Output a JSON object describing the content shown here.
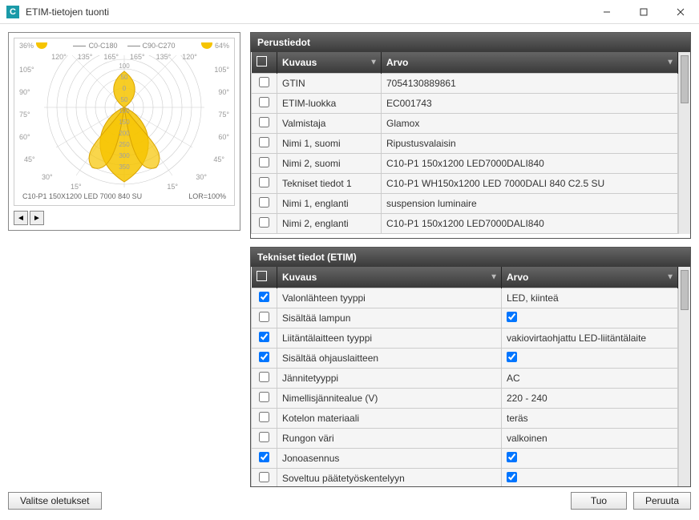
{
  "window": {
    "title": "ETIM-tietojen tuonti",
    "icon_letter": "C"
  },
  "preview": {
    "pct_left": "36%",
    "pct_right": "64%",
    "legend1": "C0-C180",
    "legend2": "C90-C270",
    "caption_left": "C10-P1 150X1200 LED 7000 840 SU",
    "caption_right": "LOR=100%",
    "angle_ticks": [
      "120°",
      "135°",
      "165°",
      "165°",
      "135°",
      "120°"
    ],
    "side_angles": [
      "105°",
      "90°",
      "75°",
      "60°",
      "45°",
      "30°",
      "15°",
      "0°",
      "15°",
      "30°",
      "45°",
      "60°",
      "75°",
      "90°",
      "105°"
    ],
    "ring_values": [
      "100",
      "50",
      "0",
      "50",
      "100",
      "150",
      "200",
      "250",
      "300",
      "350"
    ]
  },
  "panel1": {
    "title": "Perustiedot",
    "col_desc": "Kuvaus",
    "col_val": "Arvo",
    "rows": [
      {
        "checked": false,
        "desc": "GTIN",
        "val": "7054130889861"
      },
      {
        "checked": false,
        "desc": "ETIM-luokka",
        "val": "EC001743"
      },
      {
        "checked": false,
        "desc": "Valmistaja",
        "val": "Glamox"
      },
      {
        "checked": false,
        "desc": "Nimi 1, suomi",
        "val": "Ripustusvalaisin"
      },
      {
        "checked": false,
        "desc": "Nimi 2, suomi",
        "val": "C10-P1 150x1200 LED7000DALI840"
      },
      {
        "checked": false,
        "desc": "Tekniset tiedot 1",
        "val": "C10-P1 WH150x1200 LED 7000DALI 840 C2.5 SU"
      },
      {
        "checked": false,
        "desc": "Nimi 1, englanti",
        "val": "suspension luminaire"
      },
      {
        "checked": false,
        "desc": "Nimi 2, englanti",
        "val": "C10-P1 150x1200 LED7000DALI840"
      }
    ]
  },
  "panel2": {
    "title": "Tekniset tiedot (ETIM)",
    "col_desc": "Kuvaus",
    "col_val": "Arvo",
    "rows": [
      {
        "checked": true,
        "desc": "Valonlähteen tyyppi",
        "val": "LED, kiinteä",
        "valcheck": null
      },
      {
        "checked": false,
        "desc": "Sisältää lampun",
        "val": "",
        "valcheck": true
      },
      {
        "checked": true,
        "desc": "Liitäntälaitteen tyyppi",
        "val": "vakiovirtaohjattu LED-liitäntälaite",
        "valcheck": null
      },
      {
        "checked": true,
        "desc": "Sisältää ohjauslaitteen",
        "val": "",
        "valcheck": true
      },
      {
        "checked": false,
        "desc": "Jännitetyyppi",
        "val": "AC",
        "valcheck": null
      },
      {
        "checked": false,
        "desc": "Nimellisjännitealue (V)",
        "val": "220 - 240",
        "valcheck": null
      },
      {
        "checked": false,
        "desc": "Kotelon materiaali",
        "val": "teräs",
        "valcheck": null
      },
      {
        "checked": false,
        "desc": "Rungon väri",
        "val": "valkoinen",
        "valcheck": null
      },
      {
        "checked": true,
        "desc": "Jonoasennus",
        "val": "",
        "valcheck": true
      },
      {
        "checked": false,
        "desc": "Soveltuu päätetyöskentelyyn",
        "val": "",
        "valcheck": true
      }
    ]
  },
  "footer": {
    "defaults": "Valitse oletukset",
    "import": "Tuo",
    "cancel": "Peruuta"
  },
  "chart_data": {
    "type": "polar",
    "title": "C10-P1 150X1200 LED 7000 840 SU",
    "lor": "LOR=100%",
    "planes": [
      {
        "name": "C0-C180",
        "color": "#f5c000"
      },
      {
        "name": "C90-C270",
        "color": "#aaaaaa"
      }
    ],
    "uplight_pct": 36,
    "downlight_pct": 64,
    "radial_ticks_cd_klm": [
      0,
      50,
      100,
      150,
      200,
      250,
      300,
      350
    ],
    "angle_ticks_deg": [
      0,
      15,
      30,
      45,
      60,
      75,
      90,
      105,
      120,
      135,
      165
    ],
    "series": [
      {
        "name": "C0-C180",
        "values_cd_klm": [
          350,
          330,
          280,
          200,
          120,
          60,
          30,
          20,
          30,
          50,
          80,
          100,
          110
        ]
      },
      {
        "name": "C90-C270",
        "values_cd_klm": [
          340,
          320,
          270,
          190,
          115,
          55,
          25,
          18,
          28,
          48,
          78,
          98,
          108
        ]
      }
    ],
    "note": "values are estimated from rendered polar curve; angles 0..180 in 15° steps"
  }
}
